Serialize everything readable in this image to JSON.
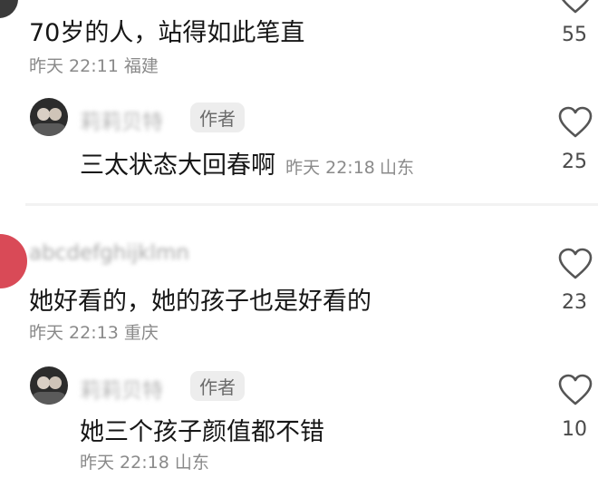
{
  "comments": [
    {
      "text": "70岁的人，站得如此笔直",
      "time": "昨天 22:11",
      "location": "福建",
      "likes": "55",
      "reply": {
        "name": "莉莉贝特",
        "author_tag": "作者",
        "text": "三太状态大回春啊",
        "time": "昨天 22:18",
        "location": "山东",
        "likes": "25"
      }
    },
    {
      "name": "abcdefghijklmn",
      "text": "她好看的，她的孩子也是好看的",
      "time": "昨天 22:13",
      "location": "重庆",
      "likes": "23",
      "reply": {
        "name": "莉莉贝特",
        "author_tag": "作者",
        "text": "她三个孩子颜值都不错",
        "time": "昨天 22:18",
        "location": "山东",
        "likes": "10"
      }
    }
  ],
  "colors": {
    "heart_outline": "#555555",
    "author_tag_bg": "#ededed",
    "avatar_red": "#d94a57"
  }
}
